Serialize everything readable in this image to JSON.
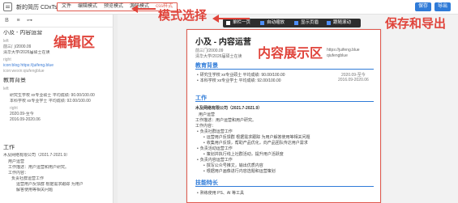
{
  "header": {
    "app_title": "新的简历 CDxTs",
    "menu": [
      "文件",
      "编辑模式",
      "预览模式",
      "源码模式",
      "css样式"
    ],
    "save_label": "保存",
    "export_label": "导出"
  },
  "annotations": {
    "mode": "模式选择",
    "save": "保存和导出",
    "edit": "编辑区",
    "show": "内容展示区"
  },
  "editor": {
    "lines": [
      "小及 - 内容运营",
      "left",
      "前三门/2000.09",
      "清华大学/2026届硕士在读",
      "right",
      "icon:blog https://juifeng.blue",
      "icon:wexin:qiufengblue",
      "教育背景",
      "left",
      "研究生学校 xx专业硕士 平均成绩: 90.00/100.00",
      "本科学校 xx专业学士 平均成绩: 92.00/100.00",
      "right",
      "2020.09-至今",
      "2016.09-2020.06",
      "工作",
      "木及网络有限公司（2021.7-2021.9）",
      "用户运营",
      "工作描述：用户运营和用户研究。",
      "工作内容：",
      "负责社群运营工作",
      "运营用户反馈群 根据需求跟踪 为用户",
      "解答使用等相关问题"
    ]
  },
  "preview_toolbar": {
    "items": [
      "单栏一页",
      "自动缩放",
      "显示页眉",
      "跟随滚动"
    ]
  },
  "resume": {
    "name": "小及 - 内容运营",
    "info_left": [
      "前三门/2000.09",
      "清华大学/2026届硕士在读"
    ],
    "info_right": [
      "https://juifeng.blue",
      "qiufengblue"
    ],
    "sec_edu": "教育背景",
    "edu": [
      {
        "text": "研究生学校 xx专业硕士 平均成绩: 90.00/100.00",
        "date": "2020.09-至今"
      },
      {
        "text": "本科学校 xx专业学士 平均成绩: 92.00/100.00",
        "date": "2016.09-2020.06"
      }
    ],
    "sec_work": "工作",
    "company": "木及网络有限公司（2021.7-2021.9）",
    "role": "用户运营",
    "desc": "工作描述：用户运营和用户研究。",
    "content_title": "工作内容：",
    "work_items": [
      "负责社群运营工作",
      "运营用户反馈群 根据需求跟踪 为用户解答使用等相关问题",
      "收集用户反馈，帮助产品优化，向产品团队传达用户需求",
      "负责活动运营工作",
      "策划并执行线上社群活动，提升用户活跃度",
      "负责内容运营工作",
      "撰写公众号推文，输出优质内容",
      "根据用户画像进行内容选题和运营策划"
    ],
    "sec_skill": "技能特长",
    "skill_items": [
      "熟练使用 PS、AI 等工具"
    ]
  }
}
